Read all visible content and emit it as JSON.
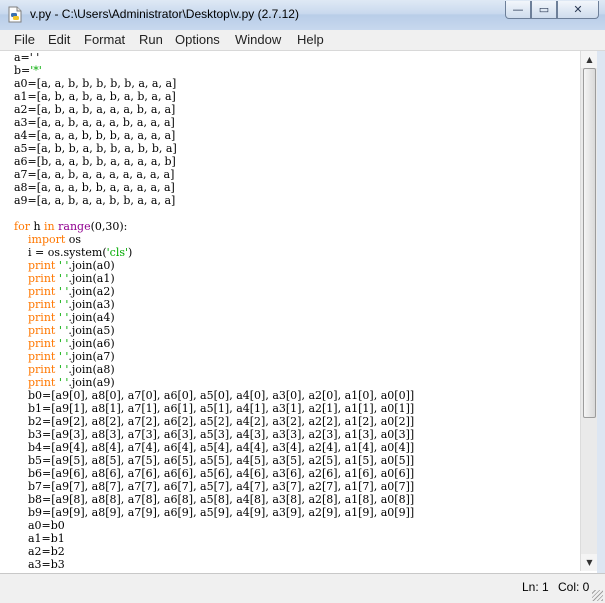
{
  "window": {
    "title": "v.py - C:\\Users\\Administrator\\Desktop\\v.py (2.7.12)",
    "controls": {
      "minimize": "—",
      "maximize": "▭",
      "close": "✕"
    }
  },
  "menubar": {
    "items": [
      "File",
      "Edit",
      "Format",
      "Run",
      "Options",
      "Window",
      "Help"
    ]
  },
  "editor": {
    "lines": [
      [
        {
          "t": "a=' '",
          "c": ""
        }
      ],
      [
        {
          "t": "b=",
          "c": ""
        },
        {
          "t": "'*'",
          "c": "str"
        }
      ],
      [
        {
          "t": "a0=[a, a, b, b, b, b, b, a, a, a]",
          "c": ""
        }
      ],
      [
        {
          "t": "a1=[a, b, a, b, a, b, a, b, a, a]",
          "c": ""
        }
      ],
      [
        {
          "t": "a2=[a, b, a, b, a, a, a, b, a, a]",
          "c": ""
        }
      ],
      [
        {
          "t": "a3=[a, a, b, a, a, a, b, a, a, a]",
          "c": ""
        }
      ],
      [
        {
          "t": "a4=[a, a, a, b, b, b, a, a, a, a]",
          "c": ""
        }
      ],
      [
        {
          "t": "a5=[a, b, b, a, b, b, a, b, b, a]",
          "c": ""
        }
      ],
      [
        {
          "t": "a6=[b, a, a, b, b, a, a, a, a, b]",
          "c": ""
        }
      ],
      [
        {
          "t": "a7=[a, a, b, a, a, a, a, a, a, a]",
          "c": ""
        }
      ],
      [
        {
          "t": "a8=[a, a, a, b, b, a, a, a, a, a]",
          "c": ""
        }
      ],
      [
        {
          "t": "a9=[a, a, b, a, a, b, b, a, a, a]",
          "c": ""
        }
      ],
      [
        {
          "t": "",
          "c": ""
        }
      ],
      [
        {
          "t": "for",
          "c": "kw"
        },
        {
          "t": " h ",
          "c": ""
        },
        {
          "t": "in",
          "c": "kw"
        },
        {
          "t": " ",
          "c": ""
        },
        {
          "t": "range",
          "c": "bi"
        },
        {
          "t": "(0,30):",
          "c": ""
        }
      ],
      [
        {
          "t": "    ",
          "c": ""
        },
        {
          "t": "import",
          "c": "kw"
        },
        {
          "t": " os",
          "c": ""
        }
      ],
      [
        {
          "t": "    i = os.system(",
          "c": ""
        },
        {
          "t": "'cls'",
          "c": "str"
        },
        {
          "t": ")",
          "c": ""
        }
      ],
      [
        {
          "t": "    ",
          "c": ""
        },
        {
          "t": "print",
          "c": "kw"
        },
        {
          "t": " ",
          "c": ""
        },
        {
          "t": "' '",
          "c": "str"
        },
        {
          "t": ".join(a0)",
          "c": ""
        }
      ],
      [
        {
          "t": "    ",
          "c": ""
        },
        {
          "t": "print",
          "c": "kw"
        },
        {
          "t": " ",
          "c": ""
        },
        {
          "t": "' '",
          "c": "str"
        },
        {
          "t": ".join(a1)",
          "c": ""
        }
      ],
      [
        {
          "t": "    ",
          "c": ""
        },
        {
          "t": "print",
          "c": "kw"
        },
        {
          "t": " ",
          "c": ""
        },
        {
          "t": "' '",
          "c": "str"
        },
        {
          "t": ".join(a2)",
          "c": ""
        }
      ],
      [
        {
          "t": "    ",
          "c": ""
        },
        {
          "t": "print",
          "c": "kw"
        },
        {
          "t": " ",
          "c": ""
        },
        {
          "t": "' '",
          "c": "str"
        },
        {
          "t": ".join(a3)",
          "c": ""
        }
      ],
      [
        {
          "t": "    ",
          "c": ""
        },
        {
          "t": "print",
          "c": "kw"
        },
        {
          "t": " ",
          "c": ""
        },
        {
          "t": "' '",
          "c": "str"
        },
        {
          "t": ".join(a4)",
          "c": ""
        }
      ],
      [
        {
          "t": "    ",
          "c": ""
        },
        {
          "t": "print",
          "c": "kw"
        },
        {
          "t": " ",
          "c": ""
        },
        {
          "t": "' '",
          "c": "str"
        },
        {
          "t": ".join(a5)",
          "c": ""
        }
      ],
      [
        {
          "t": "    ",
          "c": ""
        },
        {
          "t": "print",
          "c": "kw"
        },
        {
          "t": " ",
          "c": ""
        },
        {
          "t": "' '",
          "c": "str"
        },
        {
          "t": ".join(a6)",
          "c": ""
        }
      ],
      [
        {
          "t": "    ",
          "c": ""
        },
        {
          "t": "print",
          "c": "kw"
        },
        {
          "t": " ",
          "c": ""
        },
        {
          "t": "' '",
          "c": "str"
        },
        {
          "t": ".join(a7)",
          "c": ""
        }
      ],
      [
        {
          "t": "    ",
          "c": ""
        },
        {
          "t": "print",
          "c": "kw"
        },
        {
          "t": " ",
          "c": ""
        },
        {
          "t": "' '",
          "c": "str"
        },
        {
          "t": ".join(a8)",
          "c": ""
        }
      ],
      [
        {
          "t": "    ",
          "c": ""
        },
        {
          "t": "print",
          "c": "kw"
        },
        {
          "t": " ",
          "c": ""
        },
        {
          "t": "' '",
          "c": "str"
        },
        {
          "t": ".join(a9)",
          "c": ""
        }
      ],
      [
        {
          "t": "    b0=[a9[0], a8[0], a7[0], a6[0], a5[0], a4[0], a3[0], a2[0], a1[0], a0[0]]",
          "c": ""
        }
      ],
      [
        {
          "t": "    b1=[a9[1], a8[1], a7[1], a6[1], a5[1], a4[1], a3[1], a2[1], a1[1], a0[1]]",
          "c": ""
        }
      ],
      [
        {
          "t": "    b2=[a9[2], a8[2], a7[2], a6[2], a5[2], a4[2], a3[2], a2[2], a1[2], a0[2]]",
          "c": ""
        }
      ],
      [
        {
          "t": "    b3=[a9[3], a8[3], a7[3], a6[3], a5[3], a4[3], a3[3], a2[3], a1[3], a0[3]]",
          "c": ""
        }
      ],
      [
        {
          "t": "    b4=[a9[4], a8[4], a7[4], a6[4], a5[4], a4[4], a3[4], a2[4], a1[4], a0[4]]",
          "c": ""
        }
      ],
      [
        {
          "t": "    b5=[a9[5], a8[5], a7[5], a6[5], a5[5], a4[5], a3[5], a2[5], a1[5], a0[5]]",
          "c": ""
        }
      ],
      [
        {
          "t": "    b6=[a9[6], a8[6], a7[6], a6[6], a5[6], a4[6], a3[6], a2[6], a1[6], a0[6]]",
          "c": ""
        }
      ],
      [
        {
          "t": "    b7=[a9[7], a8[7], a7[7], a6[7], a5[7], a4[7], a3[7], a2[7], a1[7], a0[7]]",
          "c": ""
        }
      ],
      [
        {
          "t": "    b8=[a9[8], a8[8], a7[8], a6[8], a5[8], a4[8], a3[8], a2[8], a1[8], a0[8]]",
          "c": ""
        }
      ],
      [
        {
          "t": "    b9=[a9[9], a8[9], a7[9], a6[9], a5[9], a4[9], a3[9], a2[9], a1[9], a0[9]]",
          "c": ""
        }
      ],
      [
        {
          "t": "    a0=b0",
          "c": ""
        }
      ],
      [
        {
          "t": "    a1=b1",
          "c": ""
        }
      ],
      [
        {
          "t": "    a2=b2",
          "c": ""
        }
      ],
      [
        {
          "t": "    a3=b3",
          "c": ""
        }
      ]
    ]
  },
  "scrollbar": {
    "up": "▲",
    "down": "▼",
    "thumb_position": 0.0,
    "thumb_fraction": 0.72
  },
  "statusbar": {
    "line": "Ln: 1",
    "col": "Col: 0"
  },
  "colors": {
    "keyword": "#ff7700",
    "builtin": "#900090",
    "string": "#00aa00",
    "text": "#000000"
  },
  "icons": {
    "app": "python-file-icon"
  }
}
